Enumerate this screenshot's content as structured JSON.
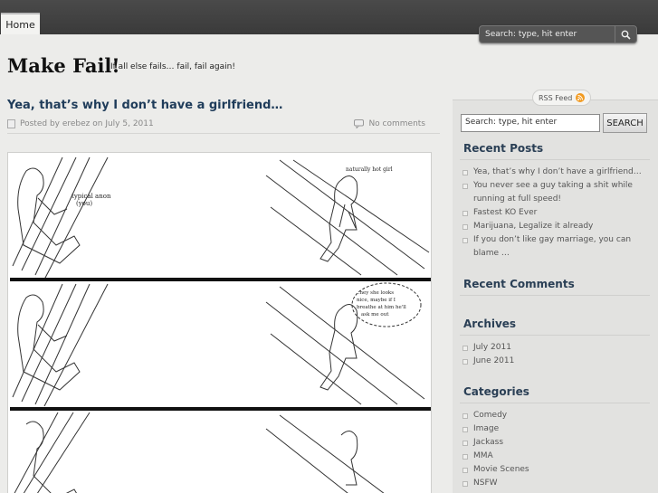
{
  "nav": {
    "home": "Home"
  },
  "top_search": {
    "placeholder": "Search: type, hit enter"
  },
  "site": {
    "title": "Make Fail!",
    "tagline": "If all else fails… fail, fail again!"
  },
  "post": {
    "title": "Yea, that’s why I don’t have a girlfriend…",
    "meta": "Posted by erebez on July 5, 2011",
    "comments": "No comments",
    "comic": {
      "label_anon": "typical anon\n(you)",
      "label_girl": "naturally hot girl",
      "bubble": "..hey she looks nice, maybe if I breathe at him he'll ask me out"
    }
  },
  "sidebar": {
    "rss": "RSS Feed",
    "search_value": "Search: type, hit enter",
    "search_button": "SEARCH",
    "recent_posts_title": "Recent Posts",
    "recent_posts": [
      "Yea, that’s why I don’t have a girlfriend…",
      "You never see a guy taking a shit while running at full speed!",
      "Fastest KO Ever",
      "Marijuana, Legalize it already",
      "If you don’t like gay marriage, you can blame …"
    ],
    "recent_comments_title": "Recent Comments",
    "archives_title": "Archives",
    "archives": [
      "July 2011",
      "June 2011"
    ],
    "categories_title": "Categories",
    "categories": [
      "Comedy",
      "Image",
      "Jackass",
      "MMA",
      "Movie Scenes",
      "NSFW"
    ]
  },
  "colors": {
    "topbar": "#3f3f3f",
    "title_blue": "#1f3c5a",
    "background": "#ececea"
  }
}
